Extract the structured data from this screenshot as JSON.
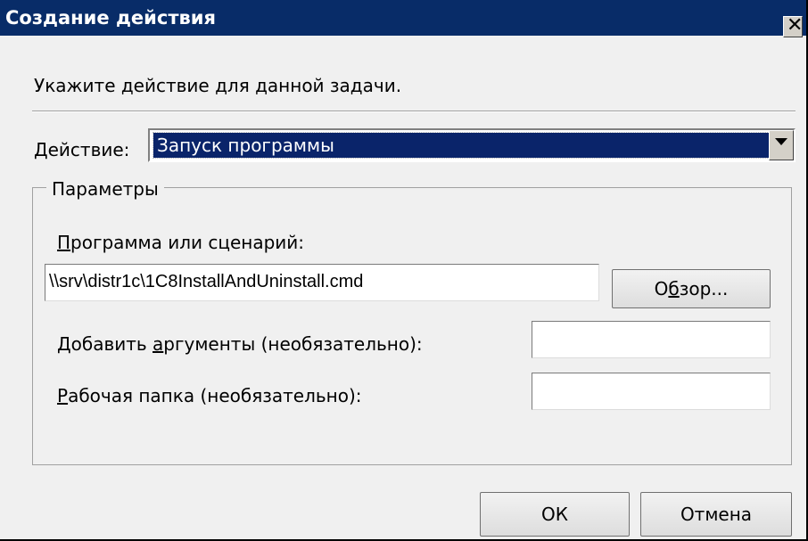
{
  "window": {
    "title": "Создание действия",
    "close_glyph": "✕"
  },
  "instruction": "Укажите действие для данной задачи.",
  "action": {
    "label_prefix": "Д",
    "label_rest": "ействие:",
    "selected": "Запуск программы"
  },
  "parameters": {
    "legend": "Параметры",
    "program_label_prefix": "П",
    "program_label_rest": "рограмма или сценарий:",
    "program_value": "\\\\srv\\distr1c\\1C8InstallAndUninstall.cmd",
    "browse_pre": "О",
    "browse_mn": "б",
    "browse_post": "зор...",
    "args_label_pre": "Добавить ",
    "args_label_mn": "а",
    "args_label_post": "ргументы (необязательно):",
    "args_value": "",
    "dir_label_mn": "Р",
    "dir_label_post": "абочая папка (необязательно):",
    "dir_value": ""
  },
  "buttons": {
    "ok": "ОК",
    "cancel": "Отмена"
  },
  "colors": {
    "title_bar": "#082c68",
    "selection": "#0a246a",
    "dialog_bg": "#f0f0f0"
  }
}
